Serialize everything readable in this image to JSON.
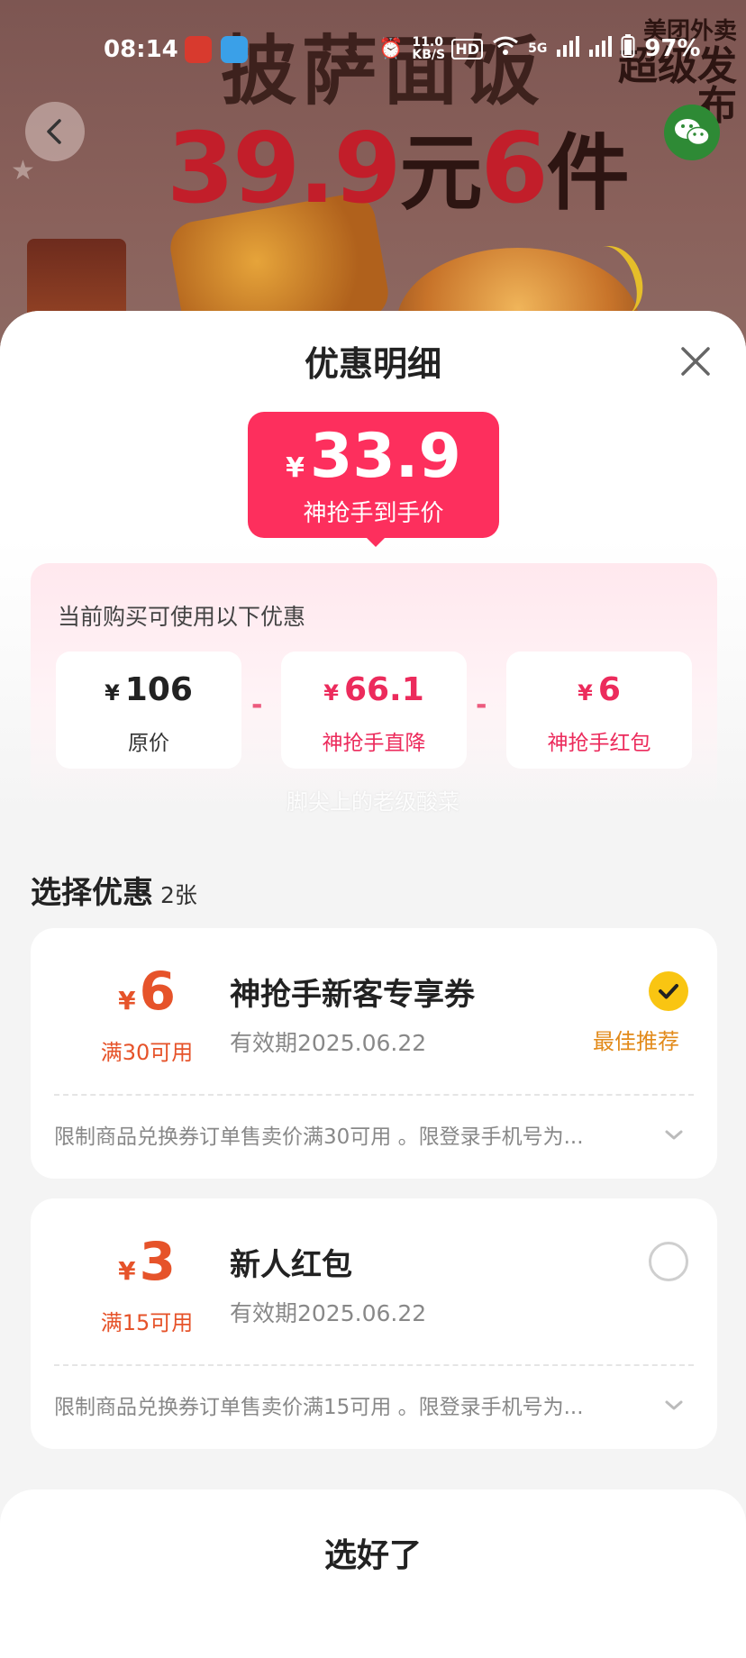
{
  "status_bar": {
    "time": "08:14",
    "net_speed": "11.0 KB/S",
    "network": "5G",
    "battery": "97%"
  },
  "banner": {
    "title": "披萨面饭",
    "price_main": "39.9",
    "price_unit": "元",
    "price_count": "6",
    "price_tail": "件",
    "brand_small": "美团外卖",
    "brand_big": "超级发布"
  },
  "sheet": {
    "title": "优惠明细",
    "final_price": {
      "currency": "¥",
      "value": "33.9",
      "label": "神抢手到手价"
    },
    "benefits": {
      "caption": "当前购买可使用以下优惠",
      "items": [
        {
          "currency": "¥",
          "value": "106",
          "label": "原价"
        },
        {
          "currency": "¥",
          "value": "66.1",
          "label": "神抢手直降"
        },
        {
          "currency": "¥",
          "value": "6",
          "label": "神抢手红包"
        }
      ],
      "operator": "-"
    },
    "watermark": "脚尖上的老级酸菜",
    "select_section": {
      "title": "选择优惠",
      "count": "2张"
    },
    "coupons": [
      {
        "currency": "¥",
        "amount": "6",
        "condition": "满30可用",
        "name": "神抢手新客专享券",
        "expire": "有效期2025.06.22",
        "selected": true,
        "badge": "最佳推荐",
        "description": "限制商品兑换券订单售卖价满30可用 。限登录手机号为..."
      },
      {
        "currency": "¥",
        "amount": "3",
        "condition": "满15可用",
        "name": "新人红包",
        "expire": "有效期2025.06.22",
        "selected": false,
        "badge": "",
        "description": "限制商品兑换券订单售卖价满15可用 。限登录手机号为..."
      }
    ],
    "confirm_label": "选好了"
  },
  "colors": {
    "accent_pink": "#fd2f5d",
    "coupon_orange": "#e6532a",
    "check_yellow": "#f9c512",
    "best_orange": "#e28a1a"
  }
}
